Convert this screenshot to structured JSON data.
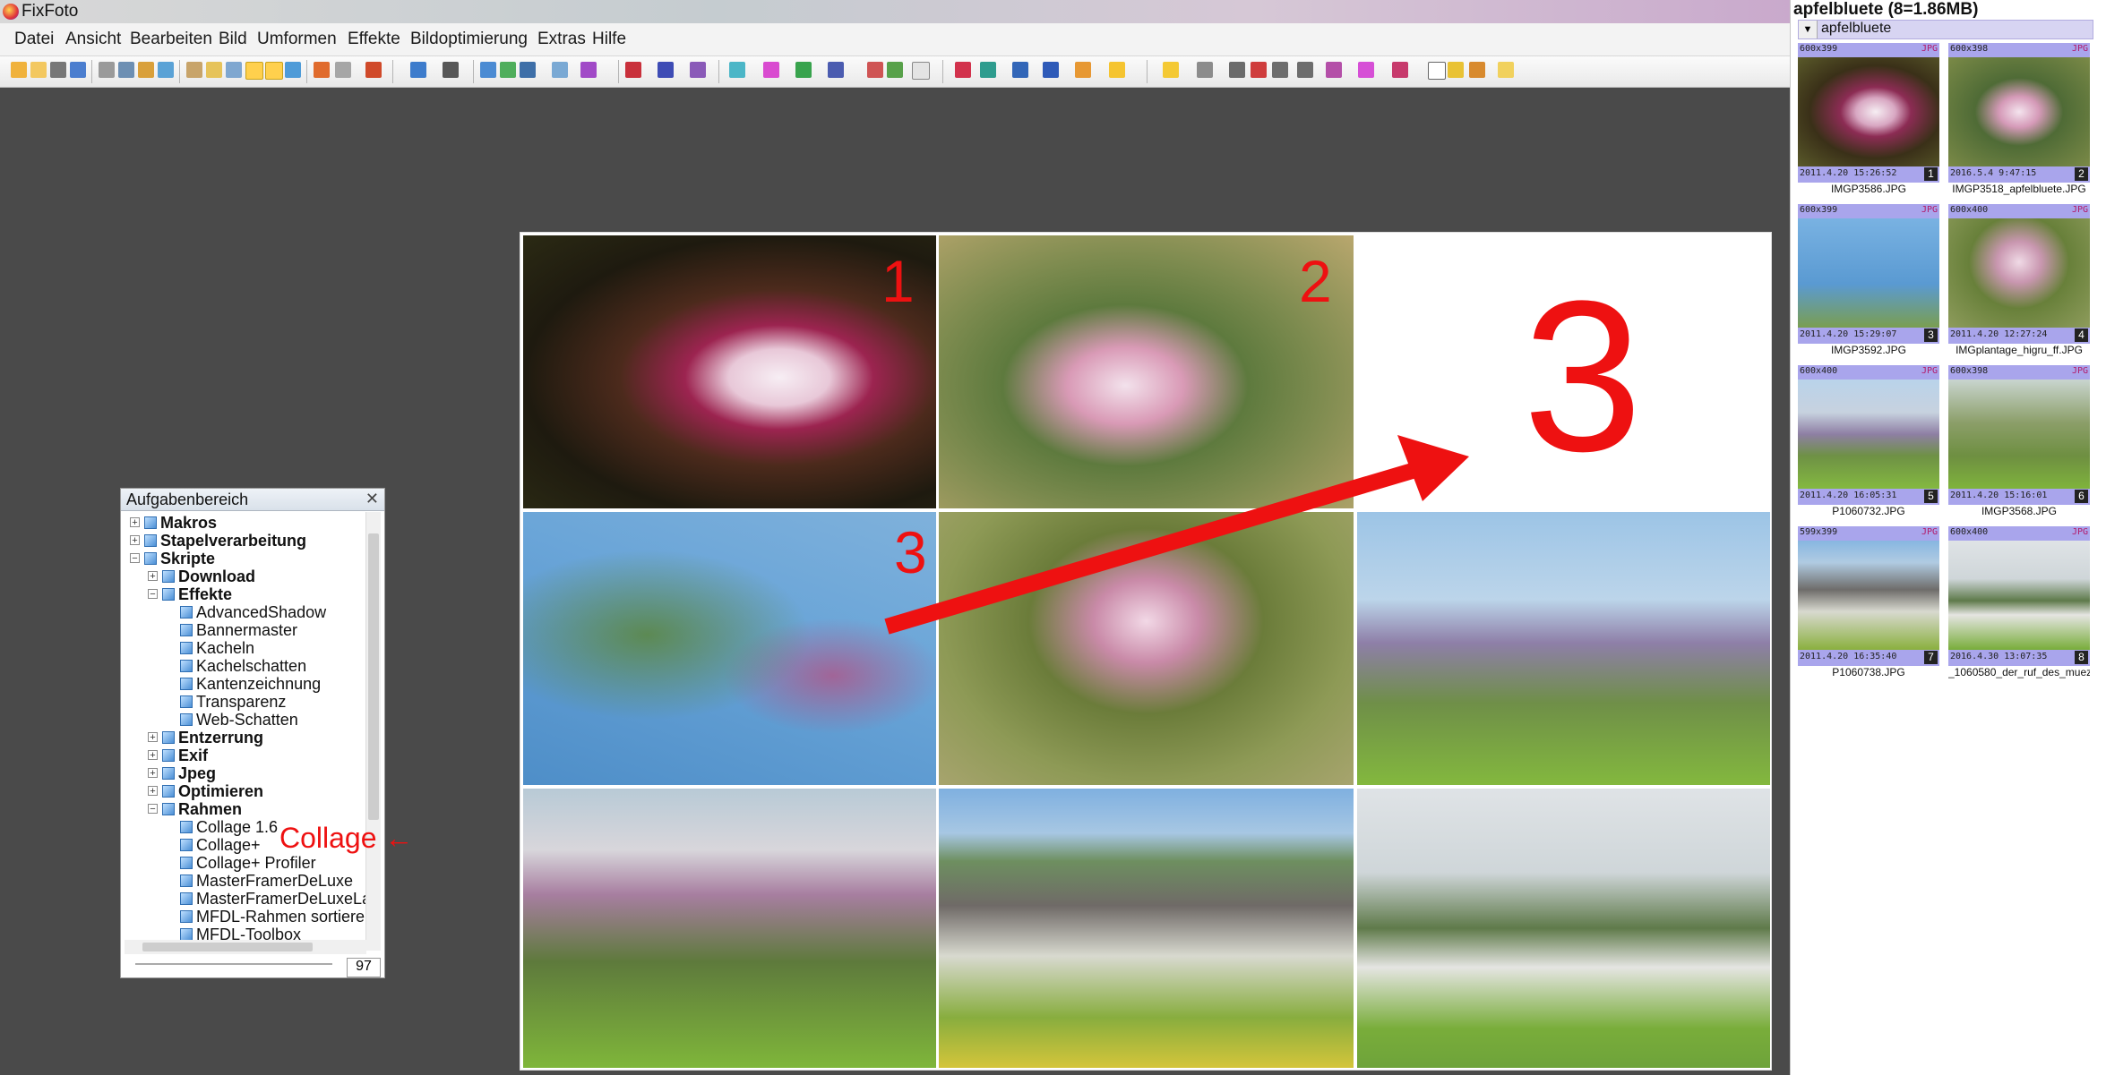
{
  "app": {
    "title": "FixFoto"
  },
  "menu": [
    "Datei",
    "Ansicht",
    "Bearbeiten",
    "Bild",
    "Umformen",
    "Effekte",
    "Bildoptimierung",
    "Extras",
    "Hilfe"
  ],
  "collage": {
    "labels": {
      "tile1": "1",
      "tile2": "2",
      "tile3": "3",
      "big": "3"
    },
    "annotation": "Collage"
  },
  "task_panel": {
    "title": "Aufgabenbereich",
    "close_icon": "close-icon",
    "items": [
      {
        "label": "Makros",
        "level": 0,
        "bold": true,
        "expander": "+"
      },
      {
        "label": "Stapelverarbeitung",
        "level": 0,
        "bold": true,
        "expander": "+"
      },
      {
        "label": "Skripte",
        "level": 0,
        "bold": true,
        "expander": "−"
      },
      {
        "label": "Download",
        "level": 1,
        "bold": true,
        "expander": "+"
      },
      {
        "label": "Effekte",
        "level": 1,
        "bold": true,
        "expander": "−"
      },
      {
        "label": "AdvancedShadow",
        "level": 2,
        "bold": false
      },
      {
        "label": "Bannermaster",
        "level": 2,
        "bold": false
      },
      {
        "label": "Kacheln",
        "level": 2,
        "bold": false
      },
      {
        "label": "Kachelschatten",
        "level": 2,
        "bold": false
      },
      {
        "label": "Kantenzeichnung",
        "level": 2,
        "bold": false
      },
      {
        "label": "Transparenz",
        "level": 2,
        "bold": false
      },
      {
        "label": "Web-Schatten",
        "level": 2,
        "bold": false
      },
      {
        "label": "Entzerrung",
        "level": 1,
        "bold": true,
        "expander": "+"
      },
      {
        "label": "Exif",
        "level": 1,
        "bold": true,
        "expander": "+"
      },
      {
        "label": "Jpeg",
        "level": 1,
        "bold": true,
        "expander": "+"
      },
      {
        "label": "Optimieren",
        "level": 1,
        "bold": true,
        "expander": "+"
      },
      {
        "label": "Rahmen",
        "level": 1,
        "bold": true,
        "expander": "−"
      },
      {
        "label": "Collage 1.6",
        "level": 2,
        "bold": false
      },
      {
        "label": "Collage+",
        "level": 2,
        "bold": false
      },
      {
        "label": "Collage+ Profiler",
        "level": 2,
        "bold": false
      },
      {
        "label": "MasterFramerDeLuxe",
        "level": 2,
        "bold": false
      },
      {
        "label": "MasterFramerDeLuxeLar",
        "level": 2,
        "bold": false
      },
      {
        "label": "MFDL-Rahmen sortierer",
        "level": 2,
        "bold": false
      },
      {
        "label": "MFDL-Toolbox",
        "level": 2,
        "bold": false
      }
    ],
    "zoom_value": "97"
  },
  "browser": {
    "header": "apfelbluete (8=1.86MB)",
    "folder": "apfelbluete",
    "thumbs": [
      {
        "dim": "600x399",
        "fmt": "JPG",
        "date": "2011.4.20 15:26:52",
        "index": "1",
        "file": "IMGP3586.JPG"
      },
      {
        "dim": "600x398",
        "fmt": "JPG",
        "date": "2016.5.4 9:47:15",
        "index": "2",
        "file": "IMGP3518_apfelbluete.JPG"
      },
      {
        "dim": "600x399",
        "fmt": "JPG",
        "date": "2011.4.20 15:29:07",
        "index": "3",
        "file": "IMGP3592.JPG"
      },
      {
        "dim": "600x400",
        "fmt": "JPG",
        "date": "2011.4.20 12:27:24",
        "index": "4",
        "file": "IMGplantage_higru_ff.JPG"
      },
      {
        "dim": "600x400",
        "fmt": "JPG",
        "date": "2011.4.20 16:05:31",
        "index": "5",
        "file": "P1060732.JPG"
      },
      {
        "dim": "600x398",
        "fmt": "JPG",
        "date": "2011.4.20 15:16:01",
        "index": "6",
        "file": "IMGP3568.JPG"
      },
      {
        "dim": "599x399",
        "fmt": "JPG",
        "date": "2011.4.20 16:35:40",
        "index": "7",
        "file": "P1060738.JPG"
      },
      {
        "dim": "600x400",
        "fmt": "JPG",
        "date": "2016.4.30 13:07:35",
        "index": "8",
        "file": "_1060580_der_ruf_des_muez..."
      }
    ]
  },
  "colors": {
    "annotation_red": "#ee1111",
    "thumb_strip": "#a9a5ec"
  }
}
